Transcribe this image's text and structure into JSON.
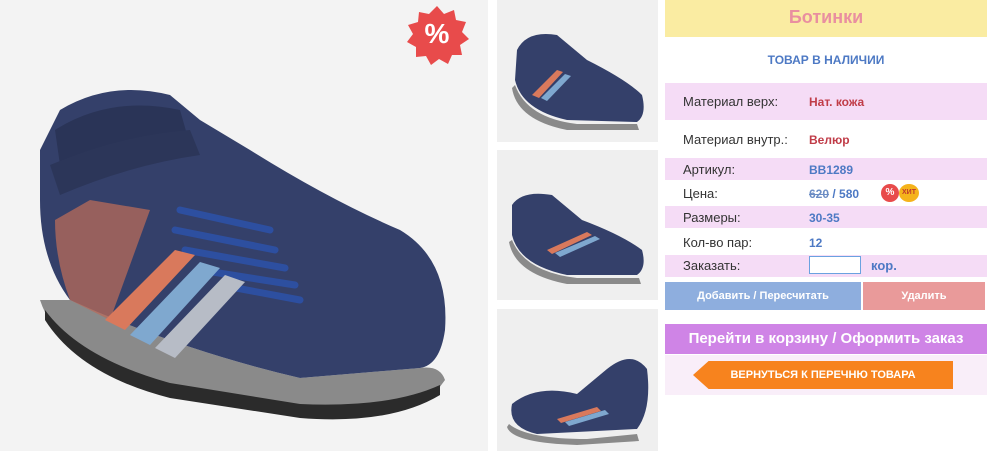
{
  "product": {
    "title": "Ботинки",
    "stock_status": "ТОВАР В НАЛИЧИИ",
    "sale_badge": "%",
    "details": [
      {
        "label": "Материал верх:",
        "value": "Нат. кожа"
      },
      {
        "label": "Материал внутр.:",
        "value": "Велюр"
      },
      {
        "label": "Артикул:",
        "value": "BB1289"
      }
    ],
    "price": {
      "label": "Цена:",
      "old": "620",
      "separator": " / ",
      "new": "580",
      "badge_sale": "%",
      "badge_hit": "ХИТ"
    },
    "sizes": {
      "label": "Размеры:",
      "value": "30-35"
    },
    "pairs": {
      "label": "Кол-во пар:",
      "value": "12"
    },
    "order": {
      "label": "Заказать:",
      "input_value": "",
      "unit": "кор."
    }
  },
  "buttons": {
    "add": "Добавить / Пересчитать",
    "delete": "Удалить",
    "cart": "Перейти в корзину / Оформить заказ",
    "back": "ВЕРНУТЬСЯ К ПЕРЕЧНЮ ТОВАРА"
  },
  "images": {
    "main": "shoe-photo-main",
    "thumbs": [
      "shoe-photo-thumb-1",
      "shoe-photo-thumb-2",
      "shoe-photo-thumb-3"
    ]
  },
  "colors": {
    "title_bg": "#faeca2",
    "title_text": "#e98fa0",
    "row_pink": "#f5dcf6",
    "accent_blue": "#4d79c4",
    "accent_red": "#c03c48",
    "btn_add": "#8eaede",
    "btn_delete": "#e99a9a",
    "btn_cart": "#cf84e6",
    "btn_back": "#f7831e"
  }
}
